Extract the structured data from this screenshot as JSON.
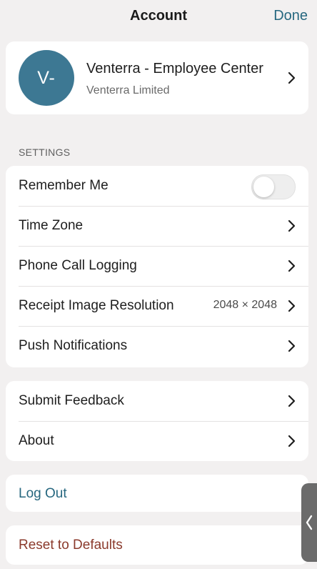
{
  "navbar": {
    "title": "Account",
    "done_label": "Done"
  },
  "profile": {
    "avatar_initials": "V-",
    "name": "Venterra - Employee Center",
    "organization": "Venterra Limited"
  },
  "settings": {
    "section_title": "SETTINGS",
    "remember_me": {
      "label": "Remember Me",
      "enabled": false
    },
    "time_zone": {
      "label": "Time Zone"
    },
    "phone_call_logging": {
      "label": "Phone Call Logging"
    },
    "receipt_image_resolution": {
      "label": "Receipt Image Resolution",
      "value": "2048 × 2048"
    },
    "push_notifications": {
      "label": "Push Notifications"
    }
  },
  "misc": {
    "submit_feedback": {
      "label": "Submit Feedback"
    },
    "about": {
      "label": "About"
    }
  },
  "actions": {
    "log_out": "Log Out",
    "reset_defaults": "Reset to Defaults"
  },
  "colors": {
    "accent": "#26677f",
    "destructive": "#8b3a2c",
    "avatar_bg": "#3d7893",
    "background": "#f2f0f0"
  },
  "icons": [
    "chevron-right-icon",
    "chevron-left-icon"
  ]
}
